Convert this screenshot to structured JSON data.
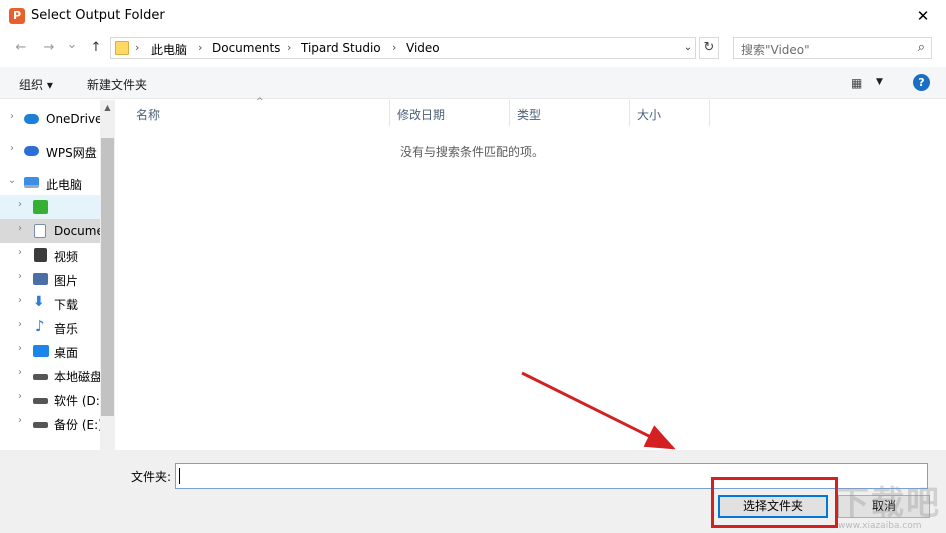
{
  "window": {
    "title": "Select Output Folder",
    "app_icon_glyph": "P",
    "close_glyph": "✕"
  },
  "nav": {
    "back_glyph": "←",
    "forward_glyph": "→",
    "recent_glyph": "⌄",
    "up_glyph": "↑",
    "refresh_glyph": "↻",
    "dropdown_glyph": "⌄"
  },
  "address": {
    "crumbs": [
      "此电脑",
      "Documents",
      "Tipard Studio",
      "Video"
    ],
    "separator": "›"
  },
  "search": {
    "placeholder": "搜索\"Video\"",
    "icon_glyph": "⌕"
  },
  "toolbar": {
    "organize": "组织 ▾",
    "new_folder": "新建文件夹",
    "view_glyph": "▦",
    "view_drop_glyph": "▼",
    "help_glyph": "?"
  },
  "sidebar": {
    "items": [
      {
        "label": "OneDrive",
        "icon": "cloud-icon",
        "color": "#1e7fd6"
      },
      {
        "label": "WPS网盘",
        "icon": "cloud-icon",
        "color": "#2c6ed8"
      },
      {
        "label": "此电脑",
        "icon": "computer-icon",
        "color": "#3a8ee6"
      },
      {
        "label": "",
        "icon": "app-icon",
        "color": "#35b034"
      },
      {
        "label": "Docume",
        "icon": "document-icon",
        "color": "#7a8da6"
      },
      {
        "label": "视频",
        "icon": "video-icon",
        "color": "#3b3b3b"
      },
      {
        "label": "图片",
        "icon": "picture-icon",
        "color": "#4a6fa5"
      },
      {
        "label": "下载",
        "icon": "download-icon",
        "color": "#2a7de0"
      },
      {
        "label": "音乐",
        "icon": "music-icon",
        "color": "#2a7de0"
      },
      {
        "label": "桌面",
        "icon": "desktop-icon",
        "color": "#1c86e8"
      },
      {
        "label": "本地磁盘",
        "icon": "drive-icon",
        "color": "#555555"
      },
      {
        "label": "软件 (D:",
        "icon": "drive-icon",
        "color": "#555555"
      },
      {
        "label": "备份 (E:)",
        "icon": "drive-icon",
        "color": "#555555"
      }
    ],
    "expand_glyph": "›",
    "collapse_glyph": "⌄",
    "scroll_up_glyph": "▲"
  },
  "columns": [
    "名称",
    "修改日期",
    "类型",
    "大小"
  ],
  "sort_glyph": "^",
  "empty_message": "没有与搜索条件匹配的项。",
  "footer": {
    "folder_label": "文件夹:",
    "folder_value": "",
    "select_button": "选择文件夹",
    "cancel_button": "取消"
  },
  "watermark": {
    "text": "下载吧",
    "url": "www.xiazaiba.com"
  },
  "colors": {
    "annotation_red": "#d42020",
    "accent_blue": "#0078d7"
  }
}
